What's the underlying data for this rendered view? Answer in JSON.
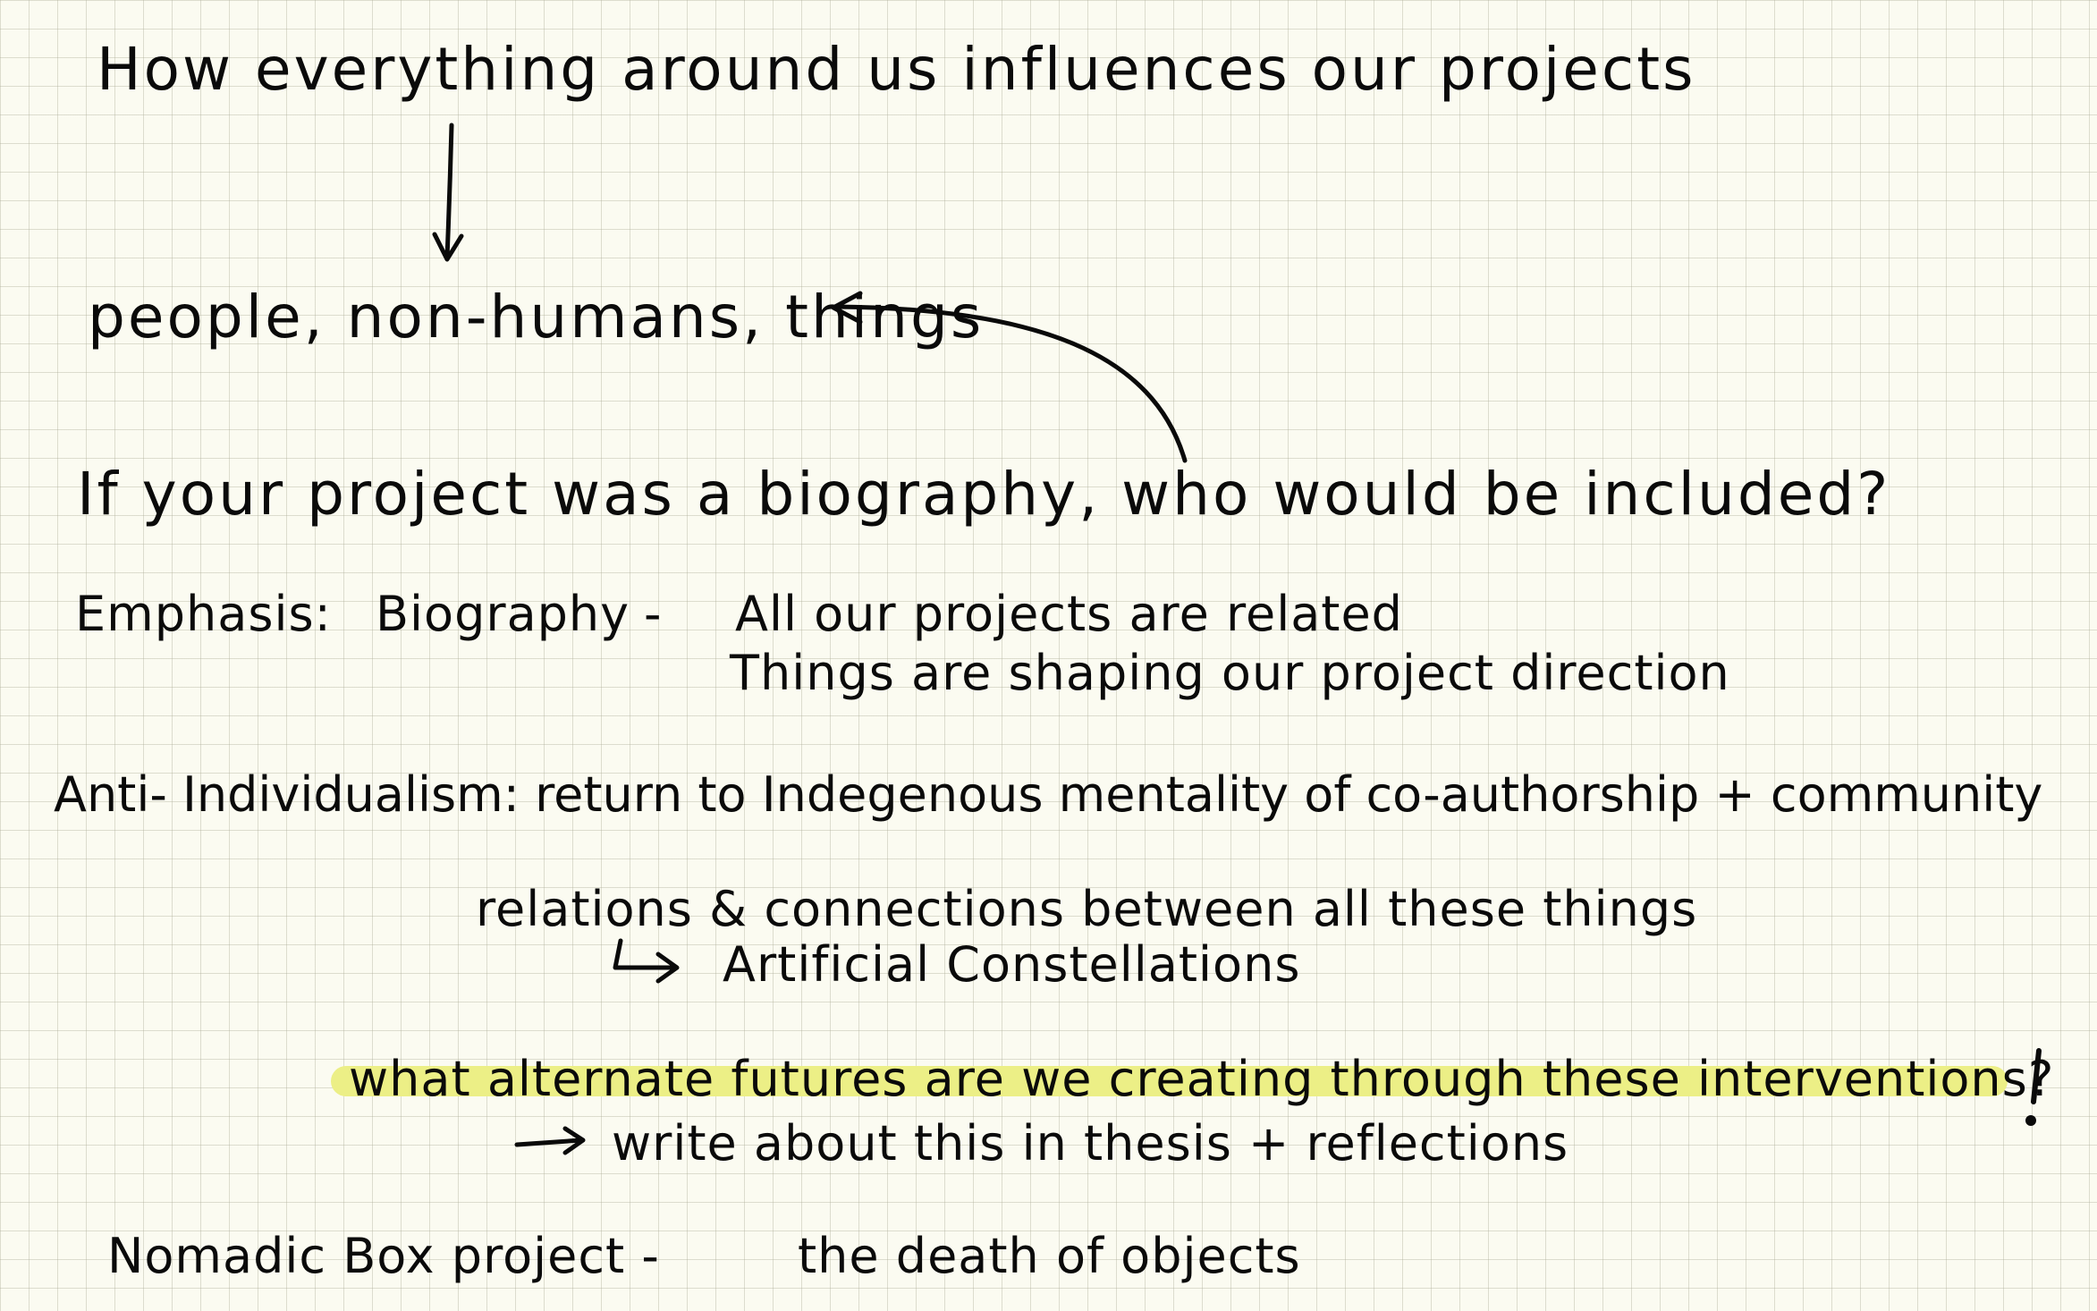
{
  "notes": {
    "title": "How everything around us influences our projects",
    "entities": "people, non-humans, things",
    "question": "If your project was a biography, who would be included?",
    "emphasis_label": "Emphasis:",
    "emphasis_term": "Biography",
    "emphasis_dash": "-",
    "emphasis_line1": "All our projects are related",
    "emphasis_line2": "Things are shaping our project direction",
    "anti_individualism": "Anti- Individualism: return to Indegenous mentality of co-authorship + community",
    "relations": "relations & connections between all these things",
    "constellations": "Artificial Constellations",
    "futures_question": "what alternate futures are we creating through these interventions?",
    "exclamation": "!",
    "write_about": "write about this in thesis + reflections",
    "nomadic_label": "Nomadic Box project -",
    "nomadic_subtitle": "the death of objects"
  },
  "colors": {
    "paper": "#fbfbf1",
    "grid": "#c9c9b6",
    "ink": "#0a0a0a",
    "highlight": "#ecef86"
  }
}
